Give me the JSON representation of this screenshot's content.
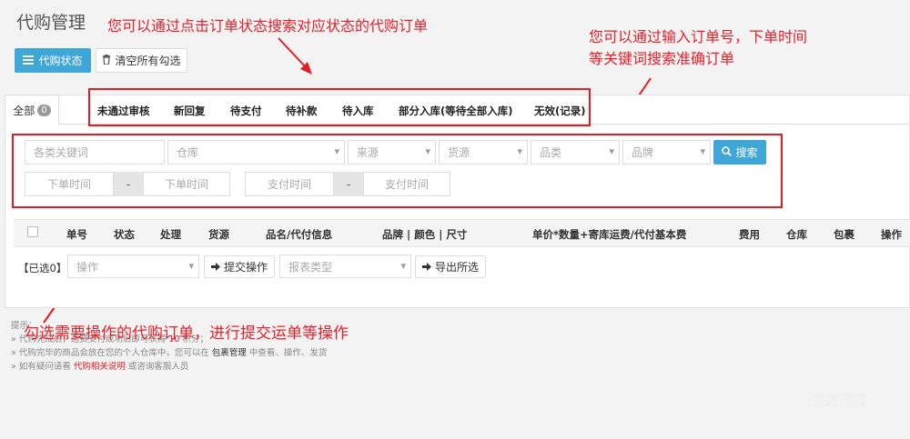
{
  "page_title": "代购管理",
  "toolbar": {
    "status_label": "代购状态",
    "clear_label": "清空所有勾选"
  },
  "annotations": {
    "status_hint": "您可以通过点击订单状态搜索对应状态的代购订单",
    "keyword_hint_line1": "您可以通过输入订单号，下单时间",
    "keyword_hint_line2": "等关键词搜索准确订单",
    "select_hint": "勾选需要操作的代购订单，进行提交运单等操作"
  },
  "tabs": {
    "all_label": "全部",
    "all_count": "0",
    "items": [
      "未通过审核",
      "新回复",
      "待支付",
      "待补款",
      "待入库",
      "部分入库(等待全部入库)",
      "无效(记录)"
    ]
  },
  "filters": {
    "keyword_placeholder": "各类关键词",
    "warehouse": "仓库",
    "source": "来源",
    "goods_source": "货源",
    "category": "品类",
    "brand": "品牌",
    "search_label": "搜索",
    "order_time_start": "下单时间",
    "order_time_end": "下单时间",
    "pay_time_start": "支付时间",
    "pay_time_end": "支付时间",
    "range_sep": "-"
  },
  "table": {
    "headers": [
      "单号",
      "状态",
      "处理",
      "货源",
      "品名/代付信息",
      "品牌 | 颜色 | 尺寸",
      "单价*数量+寄库运费/代付基本费",
      "费用",
      "仓库",
      "包裹",
      "操作"
    ]
  },
  "actions": {
    "selected_label": "【已选0】",
    "operation_placeholder": "操作",
    "submit_label": "提交操作",
    "report_placeholder": "报表类型",
    "export_label": "导出所选"
  },
  "tips": {
    "title": "提示：",
    "line1_pre": "» 代购完成后，运费支付成功后即可获得",
    "line1_points": "10",
    "line1_post": "积分；",
    "line2_pre": "» 代购完毕的商品会放在您的个人仓库中，您可以在",
    "line2_link": "包裹管理",
    "line2_post": "中查看、操作、发货",
    "line3_pre": "» 如有疑问请看",
    "line3_link": "代购相关说明",
    "line3_post": "或咨询客服人员"
  },
  "watermark": "爱转运服",
  "colors": {
    "primary": "#3fa6d8",
    "annotation": "#e41c23"
  }
}
